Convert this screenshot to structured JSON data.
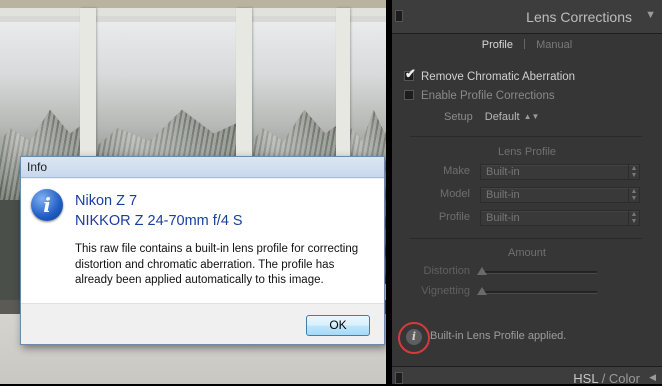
{
  "dialog": {
    "title": "Info",
    "camera": "Nikon Z 7",
    "lens": "NIKKOR Z 24-70mm f/4 S",
    "message": "This raw file contains a built-in lens profile for correcting distortion and chromatic aberration. The profile has already been applied automatically to this image.",
    "ok_label": "OK",
    "icon": "info-icon"
  },
  "panel": {
    "title": "Lens Corrections",
    "tabs": [
      {
        "label": "Profile",
        "active": true
      },
      {
        "label": "Manual",
        "active": false
      }
    ],
    "remove_ca": {
      "label": "Remove Chromatic Aberration",
      "checked": true
    },
    "enable_profile": {
      "label": "Enable Profile Corrections",
      "checked": false
    },
    "setup": {
      "label": "Setup",
      "value": "Default"
    },
    "lens_profile": {
      "heading": "Lens Profile",
      "fields": [
        {
          "label": "Make",
          "value": "Built-in"
        },
        {
          "label": "Model",
          "value": "Built-in"
        },
        {
          "label": "Profile",
          "value": "Built-in"
        }
      ]
    },
    "amount": {
      "heading": "Amount",
      "sliders": [
        {
          "label": "Distortion",
          "position": 0.0
        },
        {
          "label": "Vignetting",
          "position": 0.0
        }
      ]
    },
    "status": "Built-in Lens Profile applied.",
    "next_panel": {
      "hsl": "HSL",
      "separator": " / ",
      "color": "Color"
    }
  },
  "colors": {
    "panel_bg": "#363636",
    "highlight_ring": "#d63b3b",
    "dialog_heading": "#1a3e9e"
  }
}
